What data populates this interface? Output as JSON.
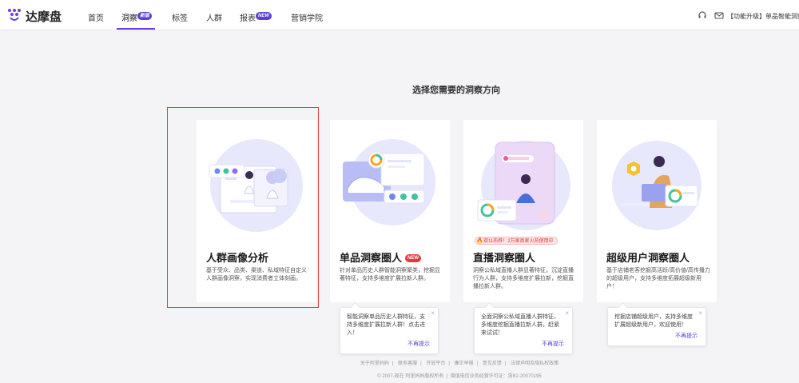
{
  "brand": {
    "name": "达摩盘"
  },
  "nav": {
    "items": [
      {
        "label": "首页"
      },
      {
        "label": "洞察",
        "badge": "新版"
      },
      {
        "label": "标签"
      },
      {
        "label": "人群"
      },
      {
        "label": "报表",
        "badge": "NEW"
      },
      {
        "label": "营销学院"
      }
    ],
    "notice": "【功能升级】单品智能洞察"
  },
  "section_title": "选择您需要的洞察方向",
  "cards": [
    {
      "title": "人群画像分析",
      "desc": "基于受众、品类、渠道、私域特征自定义人群画像洞察，实现消费者立体刻画。"
    },
    {
      "title": "单品洞察圈人",
      "badge": "NEW",
      "desc": "针对单品历史人群智能洞察聚类，挖掘显著特征，支持多维度扩展拉新人群。"
    },
    {
      "title": "直播洞察圈人",
      "hot_tag": "双11热荐！2万家商家火热使用中",
      "desc": "洞察公私域直播人群显著特征，沉淀直播行为人群，支持多维度扩展拉新，挖掘直播拉新人群。"
    },
    {
      "title": "超级用户洞察圈人",
      "desc": "基于店铺老客挖掘高活跃/高价值/高传播力的超级用户，支持多维度拓展超级新用户！"
    }
  ],
  "tips": [
    {
      "text": "智能洞察单品历史人群特征，支持多维度扩展拉新人群！点击进入！",
      "link": "不再提示"
    },
    {
      "text": "全面洞察公私域直播人群特征，多维度挖掘直播拉新人群，赶紧来试试！",
      "link": "不再提示"
    },
    {
      "text": "挖掘店铺超级用户，支持多维度扩展超级新用户，欢迎使用！",
      "link": "不再提示"
    }
  ],
  "footer": {
    "links": [
      "关于阿里妈妈",
      "联系客服",
      "开放平台",
      "廉正举报",
      "意见反馈",
      "法律声明及隐私权政策"
    ],
    "copyright": "© 2007-现在 阿里妈妈版权所有",
    "icp": "增值电信业务经营许可证：浙B2-20070195"
  },
  "colors": {
    "accent": "#5b3fd9",
    "highlight": "#e23b3b",
    "new_badge": "#e8373b"
  }
}
